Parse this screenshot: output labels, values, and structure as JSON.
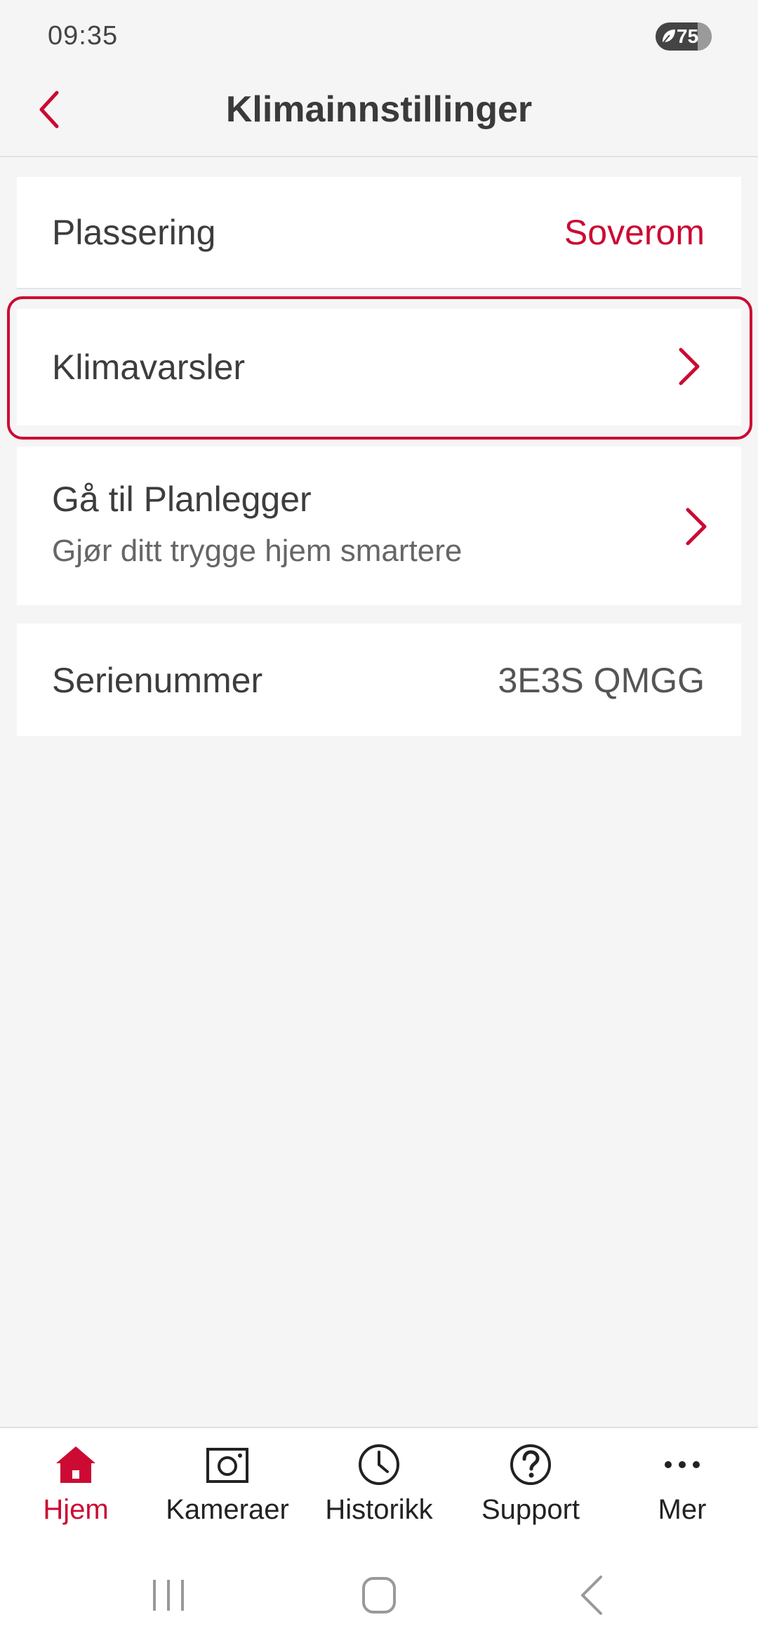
{
  "status": {
    "time": "09:35",
    "battery": "75",
    "battery_level": 0.75
  },
  "header": {
    "title": "Klimainnstillinger",
    "back_icon": "chevron-left-icon"
  },
  "rows": {
    "plassering": {
      "label": "Plassering",
      "value": "Soverom"
    },
    "klimavarsler": {
      "label": "Klimavarsler"
    },
    "planlegger": {
      "label": "Gå til Planlegger",
      "subtitle": "Gjør ditt trygge hjem smartere"
    },
    "serial": {
      "label": "Serienummer",
      "value": "3E3S QMGG"
    }
  },
  "bottom_nav": {
    "items": [
      {
        "label": "Hjem",
        "icon": "home-icon",
        "active": true
      },
      {
        "label": "Kameraer",
        "icon": "camera-icon",
        "active": false
      },
      {
        "label": "Historikk",
        "icon": "clock-icon",
        "active": false
      },
      {
        "label": "Support",
        "icon": "help-icon",
        "active": false
      },
      {
        "label": "Mer",
        "icon": "more-icon",
        "active": false
      }
    ]
  },
  "colors": {
    "accent": "#cc0a33",
    "background": "#f5f5f5",
    "card": "#ffffff",
    "text": "#3a3a3a"
  }
}
